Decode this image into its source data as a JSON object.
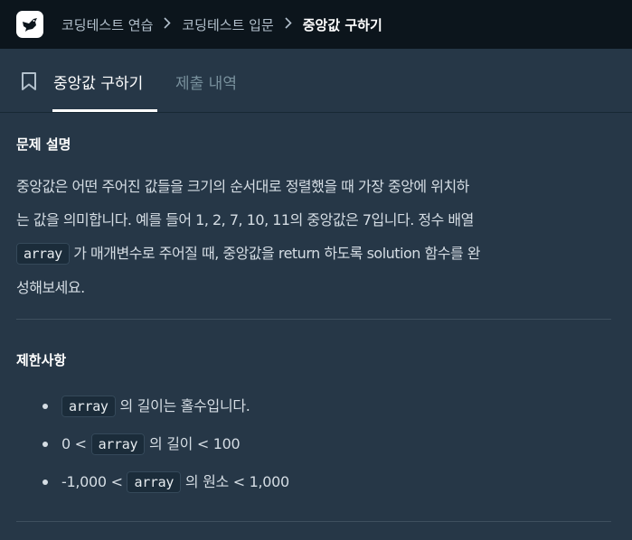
{
  "breadcrumb": {
    "items": [
      "코딩테스트 연습",
      "코딩테스트 입문",
      "중앙값 구하기"
    ]
  },
  "icons": {
    "logo": "programmers-bird-logo-icon",
    "separator": "chevron-right-icon",
    "bookmark": "bookmark-icon"
  },
  "tabs": {
    "active": "중앙값 구하기",
    "submissions": "제출 내역"
  },
  "problem": {
    "title": "문제 설명",
    "line1": "중앙값은 어떤 주어진 값들을 크기의 순서대로 정렬했을 때 가장 중앙에 위치하",
    "line2": "는 값을 의미합니다. 예를 들어 1, 2, 7, 10, 11의 중앙값은 7입니다. 정수 배열",
    "code": "array",
    "line3": " 가 매개변수로 주어질 때, 중앙값을 return 하도록 solution 함수를 완",
    "line4": "성해보세요."
  },
  "constraints": {
    "title": "제한사항",
    "items": [
      {
        "pre": "",
        "code": "array",
        "post": " 의 길이는 홀수입니다."
      },
      {
        "pre": "0 < ",
        "code": "array",
        "post": " 의 길이 < 100"
      },
      {
        "pre": "-1,000 < ",
        "code": "array",
        "post": " 의 원소 < 1,000"
      }
    ]
  },
  "colors": {
    "topbar": "#0c151c",
    "background": "#263747",
    "text": "#d5dde4",
    "inactive_tab": "#78909c"
  }
}
